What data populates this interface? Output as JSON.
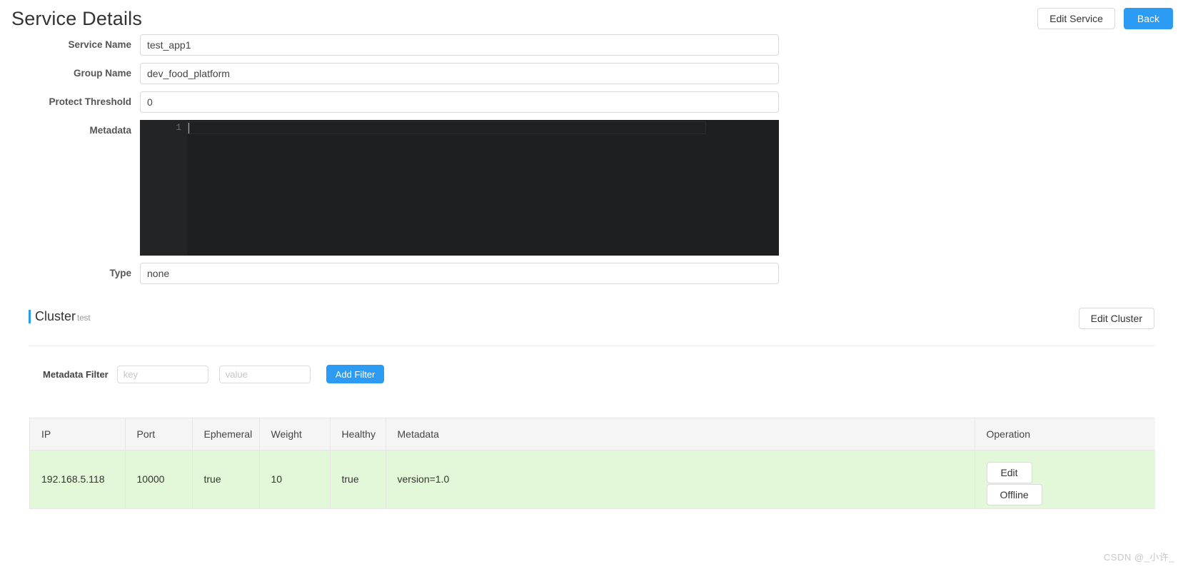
{
  "header": {
    "title": "Service Details",
    "edit_service_label": "Edit Service",
    "back_label": "Back"
  },
  "form": {
    "fields": [
      {
        "label": "Service Name",
        "value": "test_app1"
      },
      {
        "label": "Group Name",
        "value": "dev_food_platform"
      },
      {
        "label": "Protect Threshold",
        "value": "0"
      },
      {
        "label": "Metadata",
        "value": ""
      },
      {
        "label": "Type",
        "value": "none"
      }
    ],
    "editor": {
      "line_number": "1",
      "content": ""
    }
  },
  "cluster": {
    "title": "Cluster",
    "name": "test",
    "edit_cluster_label": "Edit Cluster"
  },
  "filter": {
    "label": "Metadata Filter",
    "key_placeholder": "key",
    "key_value": "",
    "value_placeholder": "value",
    "value_value": "",
    "add_filter_label": "Add Filter"
  },
  "table": {
    "columns": [
      "IP",
      "Port",
      "Ephemeral",
      "Weight",
      "Healthy",
      "Metadata",
      "Operation"
    ],
    "rows": [
      {
        "ip": "192.168.5.118",
        "port": "10000",
        "ephemeral": "true",
        "weight": "10",
        "healthy": "true",
        "metadata": "version=1.0",
        "edit_label": "Edit",
        "offline_label": "Offline"
      }
    ]
  },
  "watermark": "CSDN @_小许_",
  "colors": {
    "primary": "#2b9bf4",
    "row_highlight": "#e3f8d8",
    "editor_bg": "#1d1f21",
    "header_bg": "#f5f5f5"
  }
}
